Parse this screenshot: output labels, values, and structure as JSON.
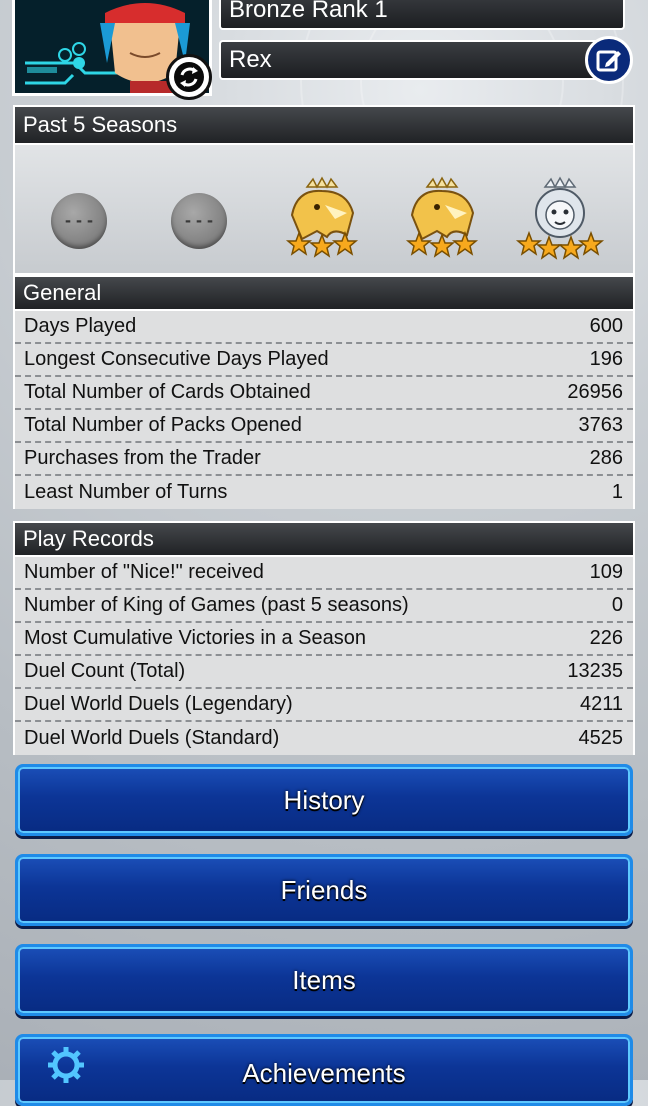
{
  "header": {
    "rank_label": "Bronze Rank 1",
    "player_name": "Rex"
  },
  "seasons": {
    "title": "Past 5 Seasons",
    "empty_badge_text": "- - -",
    "badges": [
      "empty",
      "empty",
      "gold-eagle",
      "gold-eagle",
      "silver-lion"
    ]
  },
  "general": {
    "title": "General",
    "rows": [
      {
        "label": "Days Played",
        "value": "600"
      },
      {
        "label": "Longest Consecutive Days Played",
        "value": "196"
      },
      {
        "label": "Total Number of Cards Obtained",
        "value": "26956"
      },
      {
        "label": "Total Number of Packs Opened",
        "value": "3763"
      },
      {
        "label": "Purchases from the Trader",
        "value": "286"
      },
      {
        "label": "Least Number of Turns",
        "value": "1"
      }
    ]
  },
  "play_records": {
    "title": "Play Records",
    "rows": [
      {
        "label": "Number of \"Nice!\" received",
        "value": "109"
      },
      {
        "label": "Number of King of Games (past 5 seasons)",
        "value": "0"
      },
      {
        "label": "Most Cumulative Victories in a Season",
        "value": "226"
      },
      {
        "label": "Duel Count (Total)",
        "value": "13235"
      },
      {
        "label": "Duel World Duels (Legendary)",
        "value": "4211"
      },
      {
        "label": "Duel World Duels (Standard)",
        "value": "4525"
      }
    ]
  },
  "menu": {
    "history": "History",
    "friends": "Friends",
    "items": "Items",
    "achievements": "Achievements"
  },
  "icons": {
    "switch": "refresh-icon",
    "edit": "edit-icon",
    "achievements": "gear-icon"
  },
  "colors": {
    "button_blue": "#0c3597",
    "gold": "#e0a526",
    "header_dark": "#202225"
  }
}
